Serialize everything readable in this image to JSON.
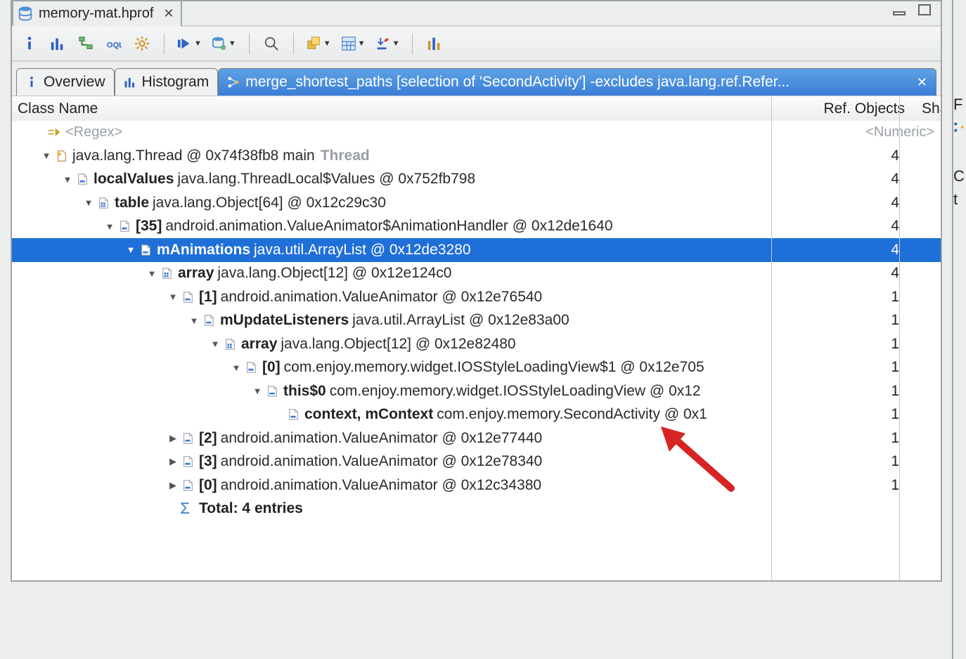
{
  "file_tab": {
    "title": "memory-mat.hprof"
  },
  "inner_tabs": {
    "overview": "Overview",
    "histogram": "Histogram",
    "merge": "merge_shortest_paths  [selection of 'SecondActivity'] -excludes java.lang.ref.Refer..."
  },
  "columns": {
    "c1": "Class Name",
    "c2": "Ref. Objects",
    "c3": "Sha"
  },
  "filters": {
    "regex": "<Regex>",
    "numeric": "<Numeric>",
    "lt": "<"
  },
  "rows": [
    {
      "indent": 1,
      "exp": "d",
      "icon": "class",
      "bold": "",
      "text": "java.lang.Thread @ 0x74f38fb8  main",
      "faded": "Thread",
      "ref": "4"
    },
    {
      "indent": 2,
      "exp": "d",
      "icon": "file",
      "bold": "localValues",
      "text": "java.lang.ThreadLocal$Values @ 0x752fb798",
      "ref": "4"
    },
    {
      "indent": 3,
      "exp": "d",
      "icon": "filearr",
      "bold": "table",
      "text": "java.lang.Object[64] @ 0x12c29c30",
      "ref": "4"
    },
    {
      "indent": 4,
      "exp": "d",
      "icon": "file",
      "bold": "[35]",
      "text": "android.animation.ValueAnimator$AnimationHandler @ 0x12de1640",
      "ref": "4"
    },
    {
      "indent": 5,
      "exp": "d",
      "icon": "file",
      "bold": "mAnimations",
      "text": "java.util.ArrayList @ 0x12de3280",
      "ref": "4",
      "sel": true
    },
    {
      "indent": 6,
      "exp": "d",
      "icon": "filearr",
      "bold": "array",
      "text": "java.lang.Object[12] @ 0x12e124c0",
      "ref": "4"
    },
    {
      "indent": 7,
      "exp": "d",
      "icon": "file",
      "bold": "[1]",
      "text": "android.animation.ValueAnimator @ 0x12e76540",
      "ref": "1"
    },
    {
      "indent": 8,
      "exp": "d",
      "icon": "file",
      "bold": "mUpdateListeners",
      "text": "java.util.ArrayList @ 0x12e83a00",
      "ref": "1"
    },
    {
      "indent": 9,
      "exp": "d",
      "icon": "filearr",
      "bold": "array",
      "text": "java.lang.Object[12] @ 0x12e82480",
      "ref": "1"
    },
    {
      "indent": 10,
      "exp": "d",
      "icon": "file",
      "bold": "[0]",
      "text": "com.enjoy.memory.widget.IOSStyleLoadingView$1 @ 0x12e705",
      "ref": "1"
    },
    {
      "indent": 11,
      "exp": "d",
      "icon": "file",
      "bold": "this$0",
      "text": "com.enjoy.memory.widget.IOSStyleLoadingView @ 0x12",
      "ref": "1"
    },
    {
      "indent": 12,
      "exp": "n",
      "icon": "file",
      "bold": "context, mContext",
      "text": "com.enjoy.memory.SecondActivity @ 0x1",
      "ref": "1"
    },
    {
      "indent": 7,
      "exp": "r",
      "icon": "file",
      "bold": "[2]",
      "text": "android.animation.ValueAnimator @ 0x12e77440",
      "ref": "1"
    },
    {
      "indent": 7,
      "exp": "r",
      "icon": "file",
      "bold": "[3]",
      "text": "android.animation.ValueAnimator @ 0x12e78340",
      "ref": "1"
    },
    {
      "indent": 7,
      "exp": "r",
      "icon": "file",
      "bold": "[0]",
      "text": "android.animation.ValueAnimator @ 0x12c34380",
      "ref": "1"
    },
    {
      "indent": 7,
      "exp": "n",
      "icon": "sigma",
      "bold": "Total: 4 entries",
      "text": "",
      "ref": ""
    }
  ],
  "right_hints": [
    "F",
    "",
    "",
    "C",
    "t"
  ]
}
